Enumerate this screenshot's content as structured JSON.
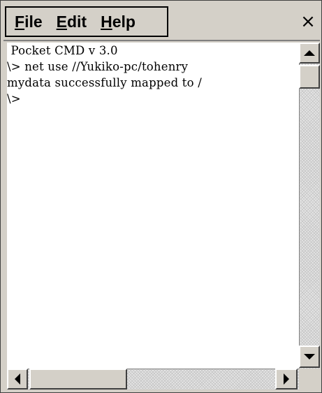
{
  "menu": {
    "items": [
      {
        "accel": "F",
        "rest": "ile"
      },
      {
        "accel": "E",
        "rest": "dit"
      },
      {
        "accel": "H",
        "rest": "elp"
      }
    ],
    "close_label": "×"
  },
  "console": {
    "lines": [
      " Pocket CMD v 3.0",
      "\\> net use //Yukiko-pc/tohenry",
      "mydata successfully mapped to /",
      "\\>"
    ]
  },
  "icons": {
    "close": "close-icon",
    "scroll_up": "arrow-up-icon",
    "scroll_down": "arrow-down-icon",
    "scroll_left": "arrow-left-icon",
    "scroll_right": "arrow-right-icon"
  },
  "colors": {
    "chrome": "#d4d0c8",
    "console_bg": "#ffffff",
    "text": "#000000"
  }
}
